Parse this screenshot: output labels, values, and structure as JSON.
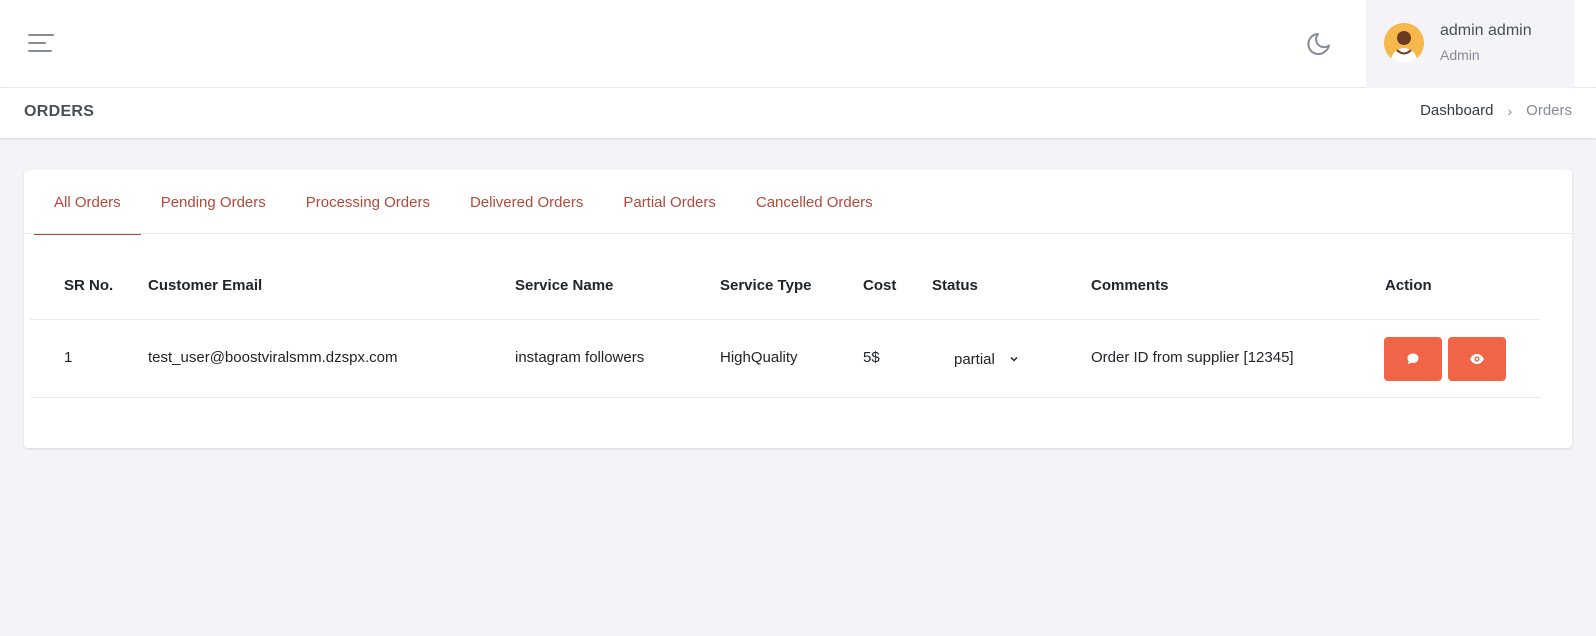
{
  "header": {
    "menu_icon": "hamburger-icon",
    "theme_icon": "moon-icon",
    "user": {
      "name": "admin admin",
      "role": "Admin"
    }
  },
  "page": {
    "title": "ORDERS",
    "breadcrumb": {
      "home": "Dashboard",
      "separator": "›",
      "current": "Orders"
    }
  },
  "tabs": [
    {
      "label": "All Orders",
      "active": true
    },
    {
      "label": "Pending Orders",
      "active": false
    },
    {
      "label": "Processing Orders",
      "active": false
    },
    {
      "label": "Delivered Orders",
      "active": false
    },
    {
      "label": "Partial Orders",
      "active": false
    },
    {
      "label": "Cancelled Orders",
      "active": false
    }
  ],
  "table": {
    "columns": [
      "SR No.",
      "Customer Email",
      "Service Name",
      "Service Type",
      "Cost",
      "Status",
      "Comments",
      "Action"
    ],
    "rows": [
      {
        "sr": "1",
        "email": "test_user@boostviralsmm.dzspx.com",
        "service_name": "instagram followers",
        "service_type": "HighQuality",
        "cost": "5$",
        "status": "partial",
        "comments": "Order ID from supplier [12345]",
        "actions": [
          "comment-icon",
          "eye-icon"
        ]
      }
    ]
  },
  "colors": {
    "accent": "#b14a3c",
    "action_button": "#f06548",
    "background": "#f3f3f8"
  }
}
